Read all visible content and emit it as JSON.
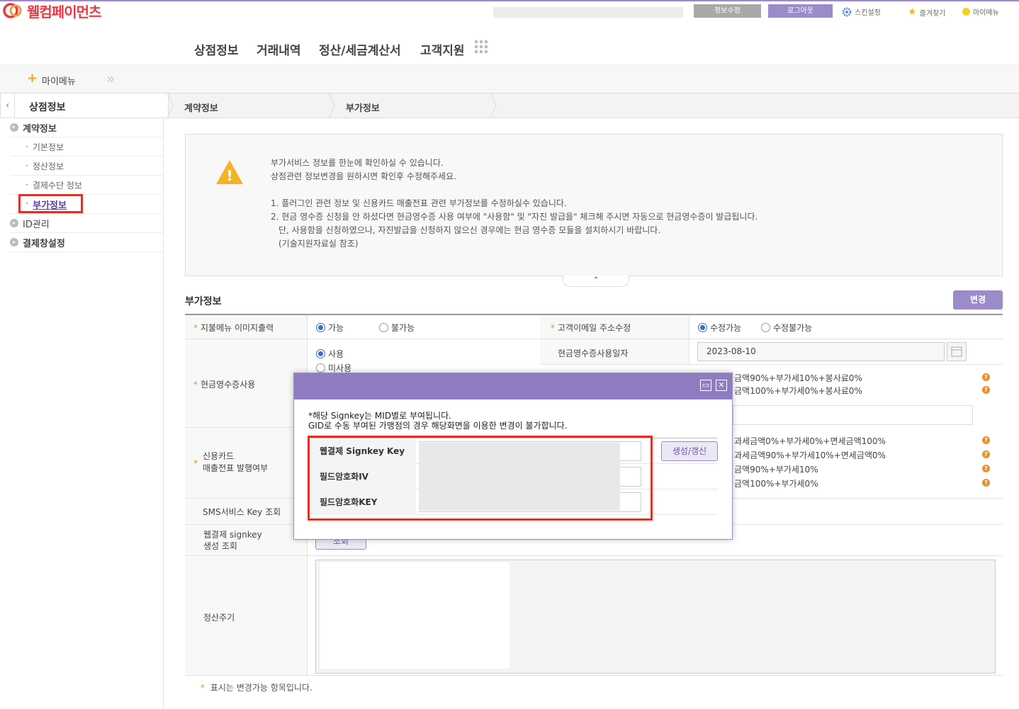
{
  "header": {
    "logo_text": "웰컴페이먼츠",
    "info_edit_label": "정보수정",
    "logout_label": "로그아웃",
    "skin_label": "스킨설정",
    "favorites_label": "즐겨찾기",
    "mymenu_label": "마이메뉴",
    "colors": {
      "info_edit": "#a8a8a8",
      "logout": "#9c8bc9",
      "brand": "#e63a46"
    }
  },
  "gnb": {
    "items": [
      "상점정보",
      "거래내역",
      "정산/세금계산서",
      "고객지원"
    ]
  },
  "mymenu_bar": {
    "label": "마이메뉴"
  },
  "breadcrumb": {
    "section": "상점정보",
    "level1": "계약정보",
    "level2": "부가정보"
  },
  "sidebar": {
    "groups": [
      {
        "label": "계약정보",
        "children": [
          "기본정보",
          "정산정보",
          "결제수단 정보",
          "부가정보"
        ]
      },
      {
        "label": "ID관리"
      },
      {
        "label": "결제창설정"
      }
    ]
  },
  "notice": {
    "line1": "부가서비스 정보를 한눈에 확인하실 수 있습니다.",
    "line2": "상점관련 정보변경을 원하시면 확인후 수정해주세요.",
    "item1": "1. 플러그인 관련 정보 및 신용카드 매출전표 관련 부가정보를 수정하실수 있습니다.",
    "item2": "2. 현금 영수증 신청을 안 하셨다면 현금영수증 사용 여부에 \"사용함\" 및 \"자진 발급을\" 체크해 주시면 자동으로 현금영수증이 발급됩니다.",
    "item2b": "단, 사용함을 신청하였으나, 자진발급을 신청하지 않으신 경우에는 현금 영수증 모듈을 설치하시기 바랍니다.",
    "item2c": "(기술지원자료실 참조)"
  },
  "form": {
    "title": "부가정보",
    "change_button": "변경",
    "row1": {
      "label": "지불메뉴 이미지출력",
      "opt1": "가능",
      "opt2": "불가능",
      "label2": "고객이메일 주소수정",
      "opt3": "수정가능",
      "opt4": "수정불가능"
    },
    "row2": {
      "label": "현금영수증사용",
      "opt1": "사용",
      "opt2": "미사용",
      "label2": "현금영수증사용일자",
      "date_value": "2023-08-10",
      "tax1": "금액90%+부가세10%+봉사료0%",
      "tax2": "금액100%+부가세0%+봉사료0%"
    },
    "row3": {
      "label_a": "신용카드",
      "label_b": "매출전표 발행여부",
      "opt1": "과세금액0%+부가세0%+면세금액100%",
      "opt2": "과세금액90%+부가세10%+면세금액0%",
      "opt3": "금액90%+부가세10%",
      "opt4": "금액100%+부가세0%"
    },
    "row4": {
      "label": "SMS서비스 Key 조회"
    },
    "row5": {
      "label_a": "웹결제 signkey",
      "label_b": "생성 조회",
      "btn": "조회"
    },
    "row6": {
      "label": "정산주기"
    },
    "footnote": "표시는 변경가능 항목입니다."
  },
  "popup": {
    "note1": "*해당 Signkey는 MID별로 부여됩니다.",
    "note2": "GID로 수동 부여된 가맹점의 경우 해당화면을 이용한 변경이 불가합니다.",
    "rows": [
      "웹결제 Signkey Key",
      "필드암호화IV",
      "필드암호화KEY"
    ],
    "generate_button": "생성/갱신",
    "close_glyph": "✕",
    "max_glyph": "▭"
  }
}
